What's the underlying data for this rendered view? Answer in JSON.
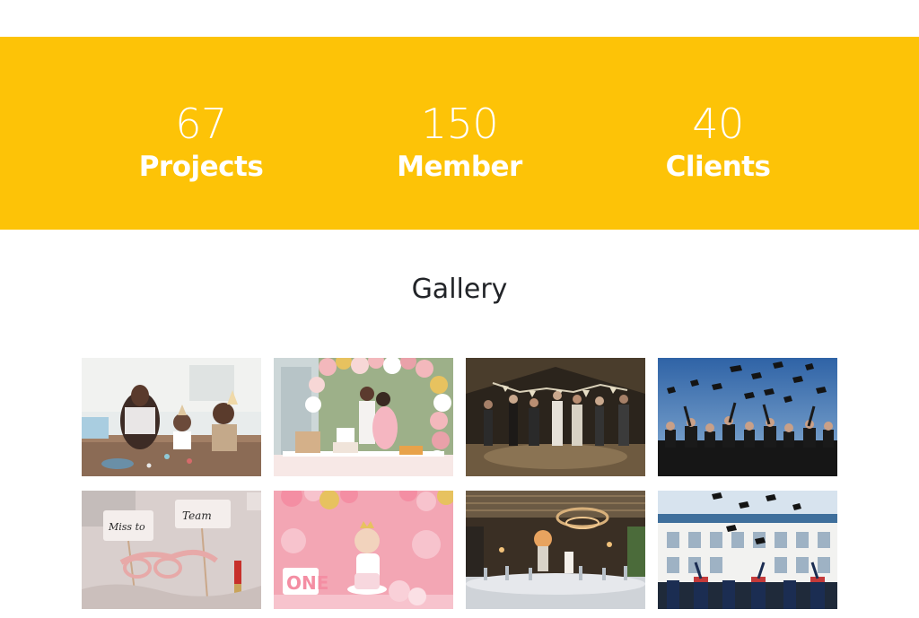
{
  "stats": [
    {
      "value": "67",
      "label": "Projects"
    },
    {
      "value": "150",
      "label": "Member"
    },
    {
      "value": "40",
      "label": "Clients"
    }
  ],
  "gallery": {
    "title": "Gallery",
    "photos": [
      {
        "subject": "kids-birthday-party"
      },
      {
        "subject": "baby-shower-balloon-arch"
      },
      {
        "subject": "dance-party-tent"
      },
      {
        "subject": "graduation-caps-sky"
      },
      {
        "subject": "bridal-party-props"
      },
      {
        "subject": "baby-cake-smash"
      },
      {
        "subject": "restaurant-banquet-hall"
      },
      {
        "subject": "graduation-building"
      }
    ]
  },
  "colors": {
    "accent": "#fdc307",
    "heading": "#222428",
    "stat_text": "#ffffff"
  }
}
